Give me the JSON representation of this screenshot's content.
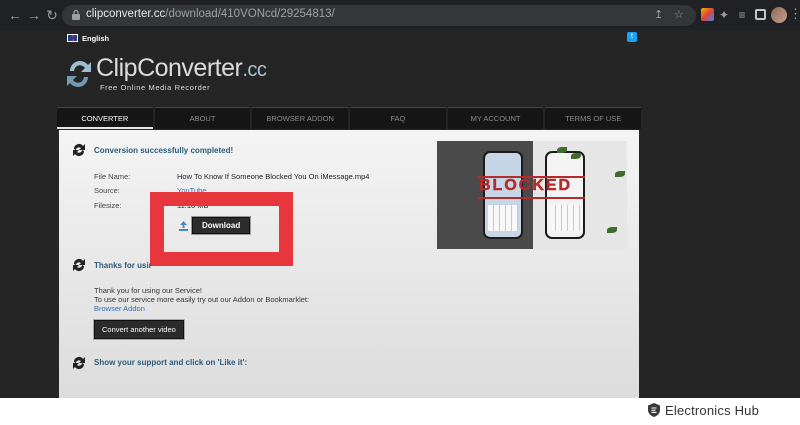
{
  "browser": {
    "url_host": "clipconverter.cc",
    "url_path": "/download/410VONcd/29254813/"
  },
  "site": {
    "language": "English",
    "logo_name": "ClipConverter",
    "logo_tld": ".cc",
    "logo_tagline": "Free Online Media Recorder"
  },
  "nav": {
    "tabs": [
      {
        "label": "CONVERTER"
      },
      {
        "label": "ABOUT"
      },
      {
        "label": "BROWSER ADDON"
      },
      {
        "label": "FAQ"
      },
      {
        "label": "MY ACCOUNT"
      },
      {
        "label": "TERMS OF USE"
      }
    ],
    "active": "CONVERTER"
  },
  "conversion": {
    "title": "Conversion successfully completed!",
    "file_name_label": "File Name:",
    "file_name": "How To Know If Someone Blocked You On iMessage.mp4",
    "source_label": "Source:",
    "source": "YouTube",
    "filesize_label": "Filesize:",
    "filesize": "11.10 MB",
    "download_label": "Download"
  },
  "thumbnail": {
    "overlay_text": "BLOCKED"
  },
  "thanks": {
    "title": "Thanks for using ClipConverter!",
    "line1": "Thank you for using our Service!",
    "line2": "To use our service more easily try out our Addon or Bookmarklet:",
    "link": "Browser Addon",
    "button": "Convert another video"
  },
  "support": {
    "title": "Show your support and click on 'Like it':"
  },
  "watermark": {
    "brand": "Electronics Hub"
  },
  "colors": {
    "highlight": "#e8363d",
    "section_title": "#2d5b7a",
    "link": "#2d6fb3"
  }
}
